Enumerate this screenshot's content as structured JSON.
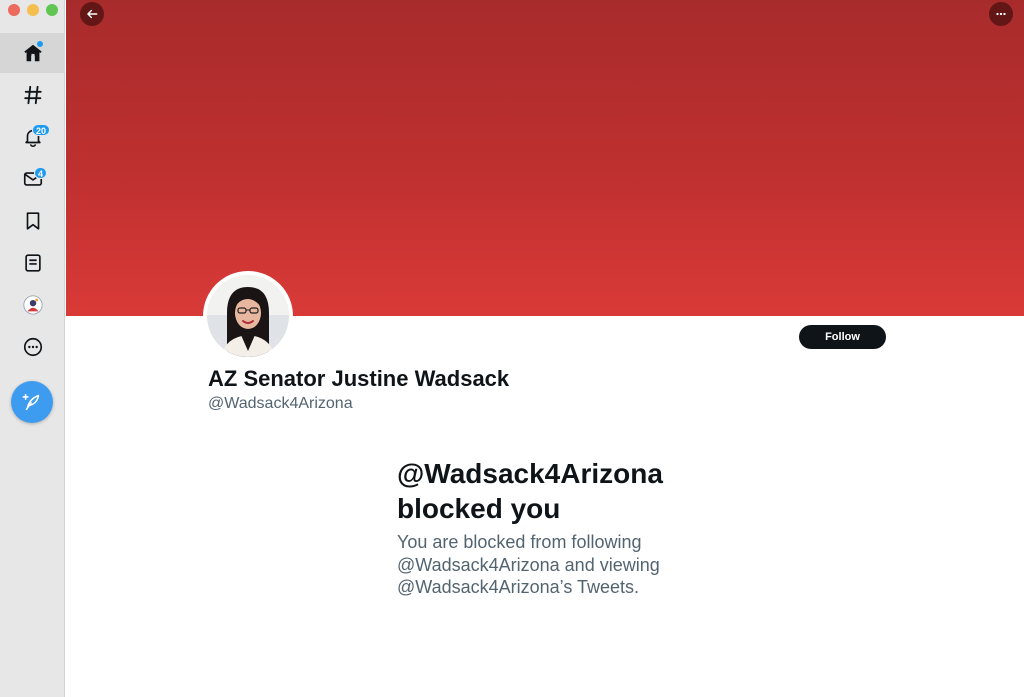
{
  "window": {
    "traffic_lights": [
      "close",
      "minimize",
      "zoom"
    ]
  },
  "sidebar": {
    "items": [
      {
        "name": "home",
        "icon": "home-icon",
        "active": true
      },
      {
        "name": "explore",
        "icon": "hashtag-icon"
      },
      {
        "name": "notifications",
        "icon": "bell-icon",
        "badge": "20"
      },
      {
        "name": "messages",
        "icon": "envelope-icon",
        "badge": "4"
      },
      {
        "name": "bookmarks",
        "icon": "bookmark-icon"
      },
      {
        "name": "lists",
        "icon": "list-icon"
      },
      {
        "name": "profile",
        "icon": "avatar-icon"
      },
      {
        "name": "more",
        "icon": "more-circle-icon"
      }
    ],
    "compose_icon": "feather-plus-icon"
  },
  "banner": {
    "colors": [
      "#a82b2b",
      "#d93a37"
    ],
    "back_icon": "arrow-left-icon",
    "more_icon": "ellipsis-icon"
  },
  "profile": {
    "display_name": "AZ Senator Justine Wadsack",
    "handle": "@Wadsack4Arizona",
    "follow_label": "Follow"
  },
  "blocked": {
    "title": "@Wadsack4Arizona blocked you",
    "description": "You are blocked from following @Wadsack4Arizona and viewing @Wadsack4Arizona’s Tweets."
  },
  "colors": {
    "accent": "#1d9bf0",
    "text_primary": "#0f1419",
    "text_secondary": "#536471"
  }
}
